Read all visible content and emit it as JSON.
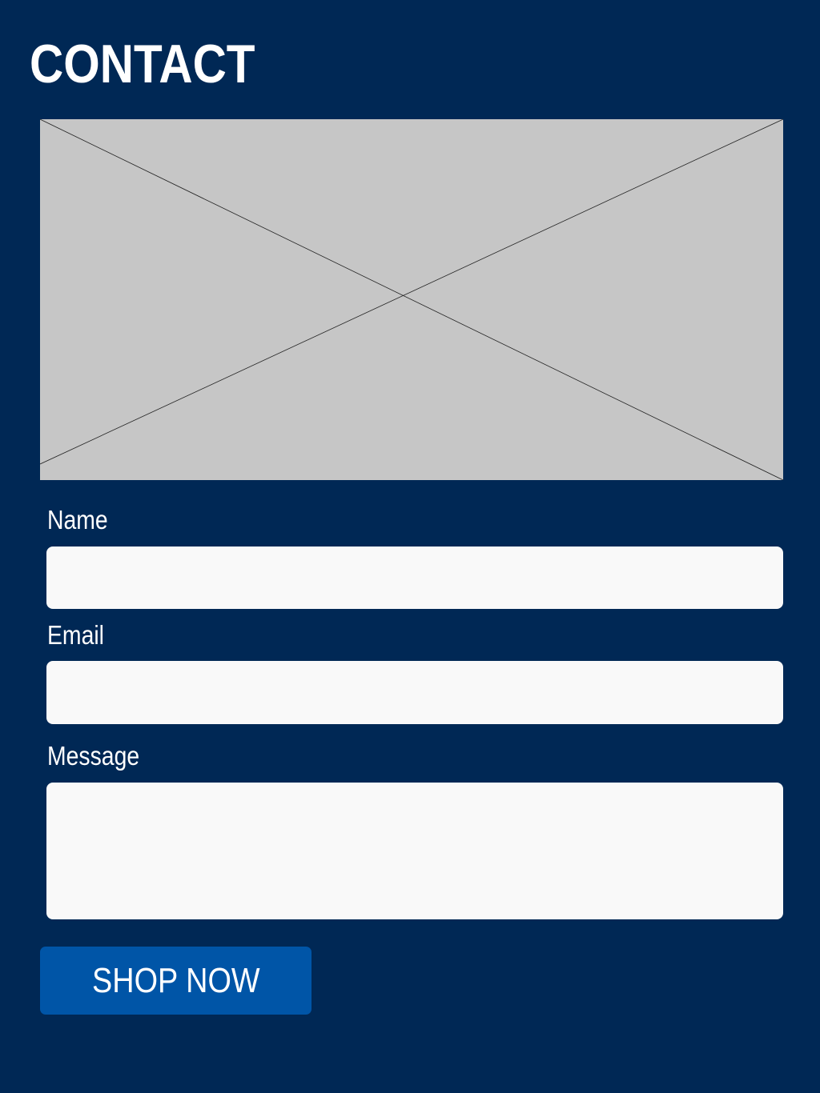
{
  "header": {
    "title": "CONTACT"
  },
  "hero_image": {
    "icon": "image-placeholder-icon"
  },
  "form": {
    "name": {
      "label": "Name",
      "value": "",
      "placeholder": ""
    },
    "email": {
      "label": "Email",
      "value": "",
      "placeholder": ""
    },
    "message": {
      "label": "Message",
      "value": "",
      "placeholder": ""
    },
    "submit_label": "SHOP NOW"
  },
  "colors": {
    "background": "#002855",
    "button": "#0055a7",
    "input_background": "#f9f9f9",
    "placeholder_image": "#c6c6c6",
    "text": "#ffffff"
  }
}
